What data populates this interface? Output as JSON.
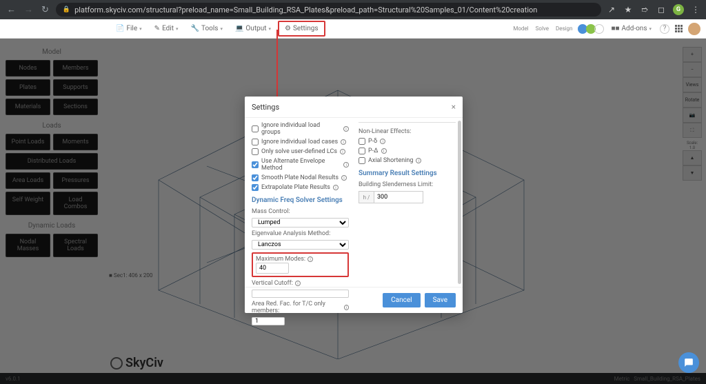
{
  "browser": {
    "url": "platform.skyciv.com/structural?preload_name=Small_Building_RSA_Plates&preload_path=Structural%20Samples_01/Content%20creation"
  },
  "menu": {
    "file": "File",
    "edit": "Edit",
    "tools": "Tools",
    "output": "Output",
    "settings": "Settings",
    "addons": "Add-ons"
  },
  "sidebar": {
    "heading_model": "Model",
    "nodes": "Nodes",
    "members": "Members",
    "plates": "Plates",
    "supports": "Supports",
    "materials": "Materials",
    "sections": "Sections",
    "heading_loads": "Loads",
    "point_loads": "Point Loads",
    "moments": "Moments",
    "distributed_loads": "Distributed Loads",
    "area_loads": "Area Loads",
    "pressures": "Pressures",
    "self_weight": "Self Weight",
    "load_combos": "Load Combos",
    "heading_dynamic": "Dynamic Loads",
    "nodal_masses": "Nodal Masses",
    "spectral_loads": "Spectral Loads"
  },
  "right_toolbar": {
    "views": "Views",
    "rotate": "Rotate",
    "scale_label": "Scale:",
    "scale_value": "1.0"
  },
  "dialog": {
    "title": "Settings",
    "chk_ignore_groups": "Ignore individual load groups",
    "chk_ignore_cases": "Ignore individual load cases",
    "chk_user_defined": "Only solve user-defined LCs",
    "chk_envelope": "Use Alternate Envelope Method",
    "chk_smooth": "Smooth Plate Nodal Results",
    "chk_extrapolate": "Extrapolate Plate Results",
    "section_dynamic": "Dynamic Freq Solver Settings",
    "mass_control_label": "Mass Control:",
    "mass_control_value": "Lumped",
    "eigen_label": "Eigenvalue Analysis Method:",
    "eigen_value": "Lanczos",
    "max_modes_label": "Maximum Modes:",
    "max_modes_value": "40",
    "vertical_cutoff_label": "Vertical Cutoff:",
    "vertical_cutoff_value": "",
    "area_red_label": "Area Red. Fac. for T/C only members:",
    "area_red_value": "1",
    "section_nonlinear": "Non-Linear Effects:",
    "pa_small": "P-δ",
    "pa_large": "P-Δ",
    "axial_shortening": "Axial Shortening",
    "section_summary": "Summary Result Settings",
    "slenderness_label": "Building Slenderness Limit:",
    "slenderness_prefix": "h /",
    "slenderness_value": "300",
    "cancel": "Cancel",
    "save": "Save"
  },
  "canvas": {
    "section_label": "Sec1: 406 x 200",
    "logo_text": "SkyCiv"
  },
  "status": {
    "version": "v6.0.1",
    "metric": "Metric",
    "filename": "Small_Building_RSA_Plates"
  }
}
